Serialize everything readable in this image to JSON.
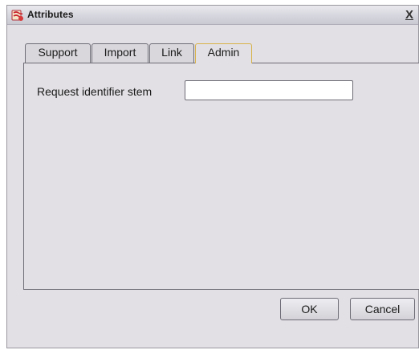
{
  "window": {
    "title": "Attributes",
    "icon": "app-icon",
    "close_label": "X"
  },
  "tabs": [
    {
      "label": "Support",
      "active": false
    },
    {
      "label": "Import",
      "active": false
    },
    {
      "label": "Link",
      "active": false
    },
    {
      "label": "Admin",
      "active": true
    }
  ],
  "admin_panel": {
    "request_identifier_stem": {
      "label": "Request identifier stem",
      "value": ""
    }
  },
  "buttons": {
    "ok_label": "OK",
    "cancel_label": "Cancel"
  },
  "colors": {
    "window_background": "#e2e0e4",
    "active_tab_border": "#d8b34a",
    "border": "#6e6c76"
  }
}
